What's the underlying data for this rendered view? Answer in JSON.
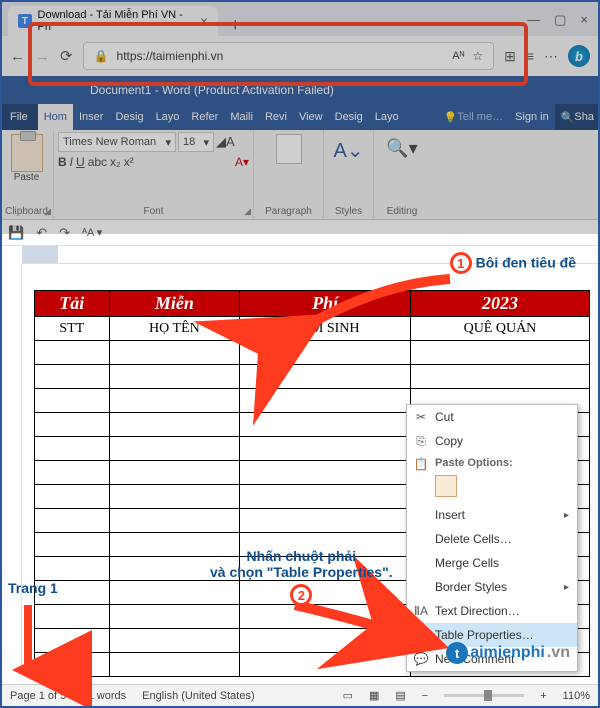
{
  "browser": {
    "tab_title": "Download - Tải Miễn Phí VN - Ph",
    "url": "https://taimienphi.vn",
    "url_icon": "A"
  },
  "word": {
    "title": "Document1 - Word (Product Activation Failed)",
    "tabs": [
      "File",
      "Hom",
      "Inser",
      "Desig",
      "Layo",
      "Refer",
      "Maili",
      "Revi",
      "View",
      "Desig",
      "Layo"
    ],
    "tell": "Tell me…",
    "signin": "Sign in",
    "share": "Sha",
    "font": "Times New Roman",
    "size": "18",
    "groups": {
      "clipboard": "Clipboard",
      "font": "Font",
      "paragraph": "Paragraph",
      "styles": "Styles",
      "editing": "Editing",
      "paste": "Paste"
    }
  },
  "table": {
    "headers": [
      "Tải",
      "Miễn",
      "Phí",
      "2023"
    ],
    "subheaders": [
      "STT",
      "HỌ TÊN",
      "NĂM SINH",
      "QUÊ QUÁN"
    ]
  },
  "ctx": {
    "cut": "Cut",
    "copy": "Copy",
    "paste_opts": "Paste Options:",
    "insert": "Insert",
    "delete": "Delete Cells…",
    "merge": "Merge Cells",
    "border": "Border Styles",
    "textdir": "Text Direction…",
    "props": "Table Properties…",
    "comment": "New Comment"
  },
  "annot": {
    "step1": "Bôi đen tiêu đề",
    "step2a": "Nhấn chuột phải",
    "step2b": "và chọn \"Table Properties\".",
    "page": "Trang 1"
  },
  "status": {
    "page": "Page 1 of 5",
    "words": "11 words",
    "lang": "English (United States)",
    "zoom": "110%"
  },
  "watermark": "aimienphi"
}
